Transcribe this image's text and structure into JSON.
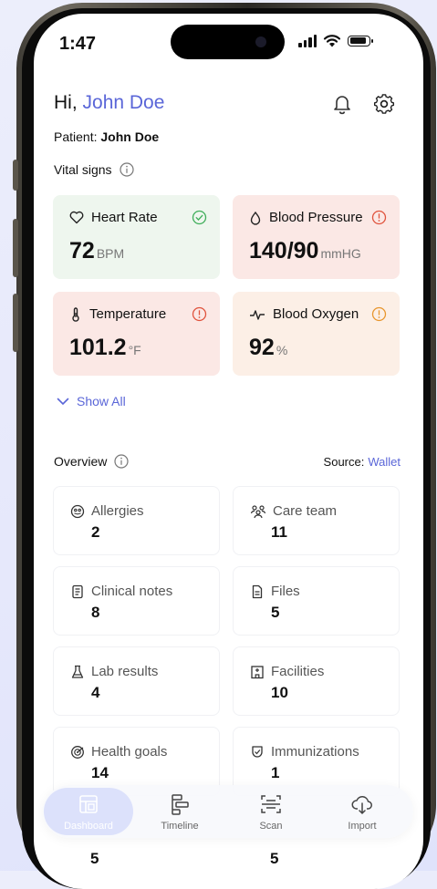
{
  "status_bar": {
    "time": "1:47"
  },
  "header": {
    "greeting": "Hi,",
    "user_name": "John Doe"
  },
  "patient": {
    "label": "Patient:",
    "name": "John Doe"
  },
  "vitals": {
    "title": "Vital signs",
    "items": [
      {
        "label": "Heart Rate",
        "value": "72",
        "unit": "BPM",
        "status": "normal",
        "icon": "heart-icon"
      },
      {
        "label": "Blood Pressure",
        "value": "140/90",
        "unit": "mmHG",
        "status": "alert",
        "icon": "droplet-icon"
      },
      {
        "label": "Temperature",
        "value": "101.2",
        "unit": "°F",
        "status": "alert",
        "icon": "thermometer-icon"
      },
      {
        "label": "Blood Oxygen",
        "value": "92",
        "unit": "%",
        "status": "warning",
        "icon": "pulse-icon"
      }
    ],
    "show_all_label": "Show All"
  },
  "overview": {
    "title": "Overview",
    "source_label": "Source:",
    "source_value": "Wallet",
    "items": [
      {
        "label": "Allergies",
        "value": "2",
        "icon": "allergy-icon"
      },
      {
        "label": "Care team",
        "value": "11",
        "icon": "care-team-icon"
      },
      {
        "label": "Clinical notes",
        "value": "8",
        "icon": "clinical-notes-icon"
      },
      {
        "label": "Files",
        "value": "5",
        "icon": "file-icon"
      },
      {
        "label": "Lab results",
        "value": "4",
        "icon": "flask-icon"
      },
      {
        "label": "Facilities",
        "value": "10",
        "icon": "facility-icon"
      },
      {
        "label": "Health goals",
        "value": "14",
        "icon": "target-icon"
      },
      {
        "label": "Immunizations",
        "value": "1",
        "icon": "immunization-icon"
      },
      {
        "label": "",
        "value": "5"
      },
      {
        "label": "",
        "value": "5"
      }
    ]
  },
  "tabbar": {
    "tabs": [
      {
        "label": "Dashboard",
        "icon": "dashboard-icon",
        "active": true
      },
      {
        "label": "Timeline",
        "icon": "timeline-icon",
        "active": false
      },
      {
        "label": "Scan",
        "icon": "scan-icon",
        "active": false
      },
      {
        "label": "Import",
        "icon": "cloud-download-icon",
        "active": false
      }
    ]
  },
  "colors": {
    "accent": "#5a66d8",
    "normal_card": "#eef6ee",
    "alert_card": "#fbe8e5",
    "warning_card": "#fcefe6",
    "ok_green": "#3fae5a",
    "alert_red": "#e0533d",
    "warning_orange": "#e8962e"
  }
}
